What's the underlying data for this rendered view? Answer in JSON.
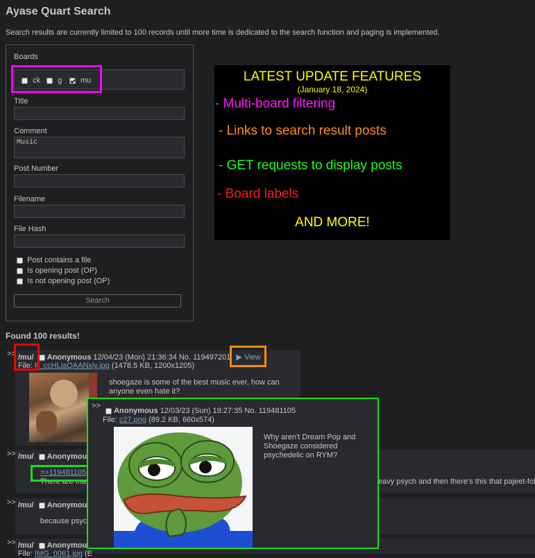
{
  "header": {
    "title": "Ayase Quart Search",
    "notice": "Search results are currently limited to 100 records until more time is dedicated to the search function and paging is implemented."
  },
  "form": {
    "boards_label": "Boards",
    "boards": [
      {
        "name": "ck",
        "checked": false
      },
      {
        "name": "g",
        "checked": false
      },
      {
        "name": "mu",
        "checked": true
      }
    ],
    "title_label": "Title",
    "title_value": "",
    "comment_label": "Comment",
    "comment_value": "Music",
    "post_number_label": "Post Number",
    "filename_label": "Filename",
    "file_hash_label": "File Hash",
    "options": [
      "Post contains a file",
      "Is opening post (OP)",
      "Is not opening post (OP)"
    ],
    "search_button": "Search"
  },
  "promo": {
    "title": "LATEST UPDATE FEATURES",
    "date": "(January 18, 2024)",
    "lines": [
      "- Multi-board filtering",
      "- Links to search result posts",
      "- GET requests to display posts",
      "- Board labels"
    ],
    "footer": "AND MORE!",
    "colors": {
      "title": "#ffff00",
      "line1": "#ff1aff",
      "line2": "#ff8c1a",
      "line3": "#1aff1a",
      "line4": "#ff1a1a"
    }
  },
  "results": {
    "count_text": "Found 100 results!",
    "post1": {
      "arrow": ">>",
      "board": "/mu/",
      "name": "Anonymous",
      "datetime": "12/04/23 (Mon) 21:36:34",
      "no": "No. 119497201",
      "view": "View",
      "file_label": "File:",
      "file_name": "F_ccHLiaQAANxiy.jpg",
      "file_meta": "(1478.5 KB, 1200x1205)",
      "comment": "shoegaze is some of the best music ever, how can anyone even hate it?"
    },
    "post2": {
      "arrow": ">>",
      "board": "/mu/",
      "name": "Anonymous",
      "quote": ">>119481105",
      "comment_start": "There are ma",
      "comment_end": "eavy psych and then there's this that pajeet-folk"
    },
    "post3": {
      "arrow": ">>",
      "board": "/mu/",
      "name": "Anonymous",
      "comment": "because psyc"
    },
    "post4": {
      "arrow": ">>",
      "board": "/mu/",
      "name": "Anonymous",
      "file_label": "File:",
      "file_name": "IMG_0061.jpg",
      "file_meta": "(E"
    }
  },
  "popup": {
    "arrow": ">>",
    "name": "Anonymous",
    "datetime": "12/03/23 (Sun) 19:27:35",
    "no": "No. 119481105",
    "file_label": "File:",
    "file_name": "c27.png",
    "file_meta": "(89.2 KB, 660x574)",
    "comment": "Why aren't Dream Pop and Shoegaze considered psychedelic on RYM?"
  },
  "annotation_colors": {
    "magenta": "#ff00ff",
    "red": "#ff0000",
    "orange": "#ff8c00",
    "green": "#1ade1a"
  }
}
